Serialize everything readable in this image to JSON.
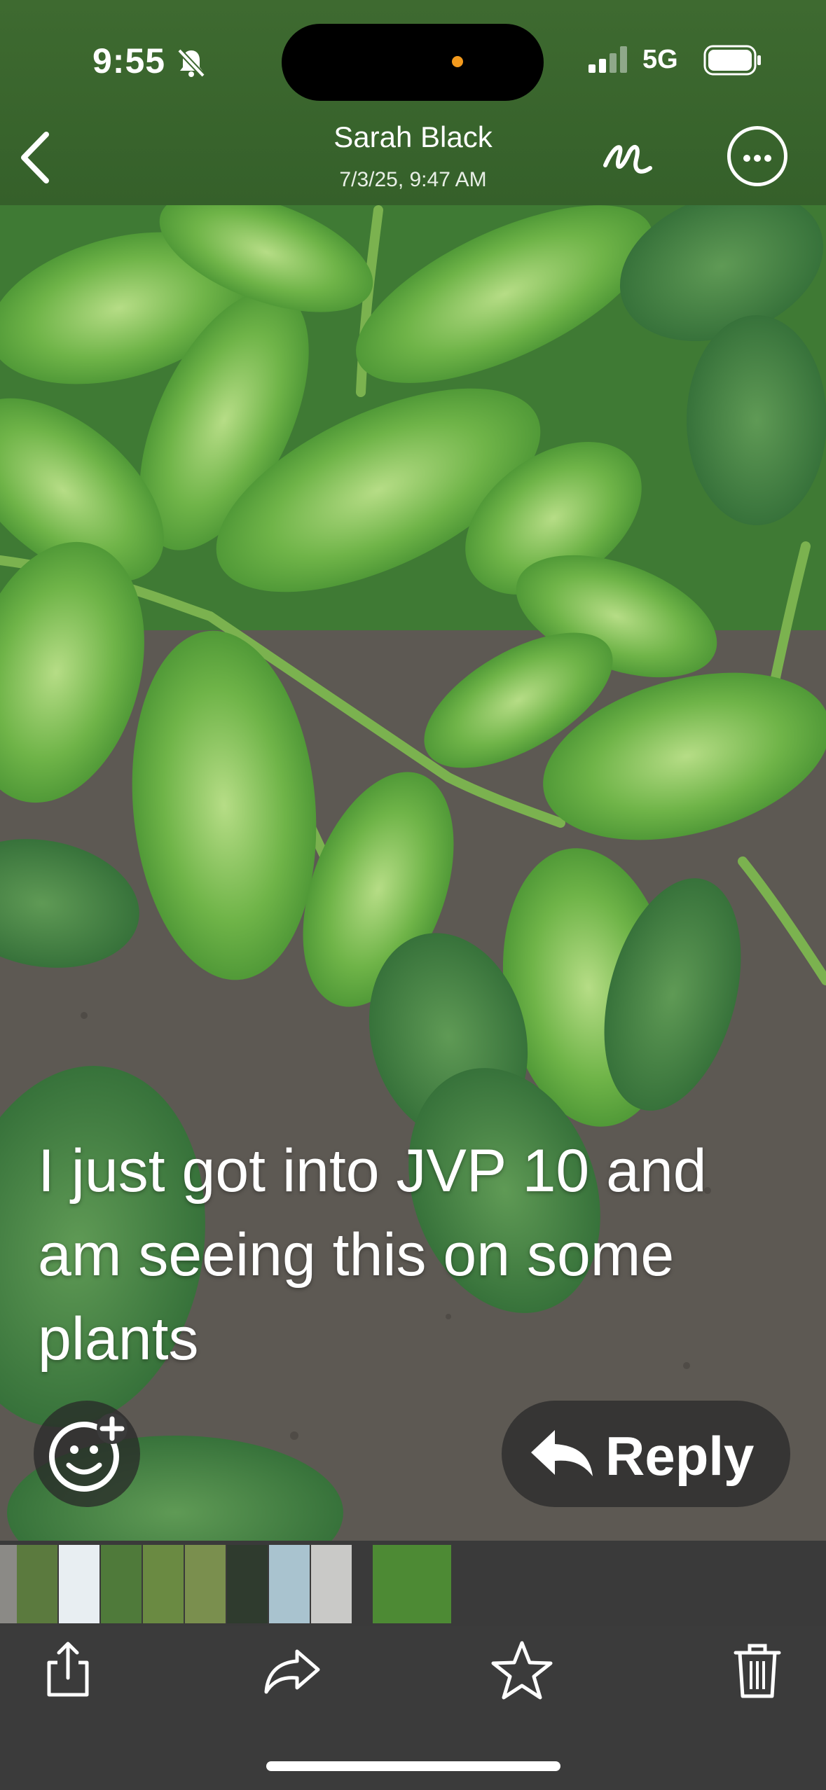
{
  "status_bar": {
    "time": "9:55",
    "network": "5G"
  },
  "header": {
    "title": "Sarah Black",
    "subtitle": "7/3/25, 9:47 AM"
  },
  "message": {
    "caption": "I just got into JVP 10 and am seeing this on some plants"
  },
  "actions": {
    "reply_label": "Reply"
  },
  "thumbnails": [
    {
      "name": "thumb-1",
      "color": "#8b8a86"
    },
    {
      "name": "thumb-2",
      "color": "#5b7a3e"
    },
    {
      "name": "thumb-3",
      "color": "#e8eef2"
    },
    {
      "name": "thumb-4",
      "color": "#4f7a3a"
    },
    {
      "name": "thumb-5",
      "color": "#6a8a42"
    },
    {
      "name": "thumb-6",
      "color": "#7a8f4e"
    },
    {
      "name": "thumb-7",
      "color": "#2f3b2e"
    },
    {
      "name": "thumb-8",
      "color": "#a9c3cf"
    },
    {
      "name": "thumb-9",
      "color": "#c9c9c7"
    },
    {
      "name": "thumb-selected",
      "color": "#4d8a34"
    }
  ],
  "toolbar": {
    "icons": [
      "share-icon",
      "forward-icon",
      "star-icon",
      "trash-icon"
    ]
  },
  "colors": {
    "header_green": "#3e6a30",
    "leaf_green": "#5aa83c",
    "toolbar_bg": "#3b3b3b"
  }
}
